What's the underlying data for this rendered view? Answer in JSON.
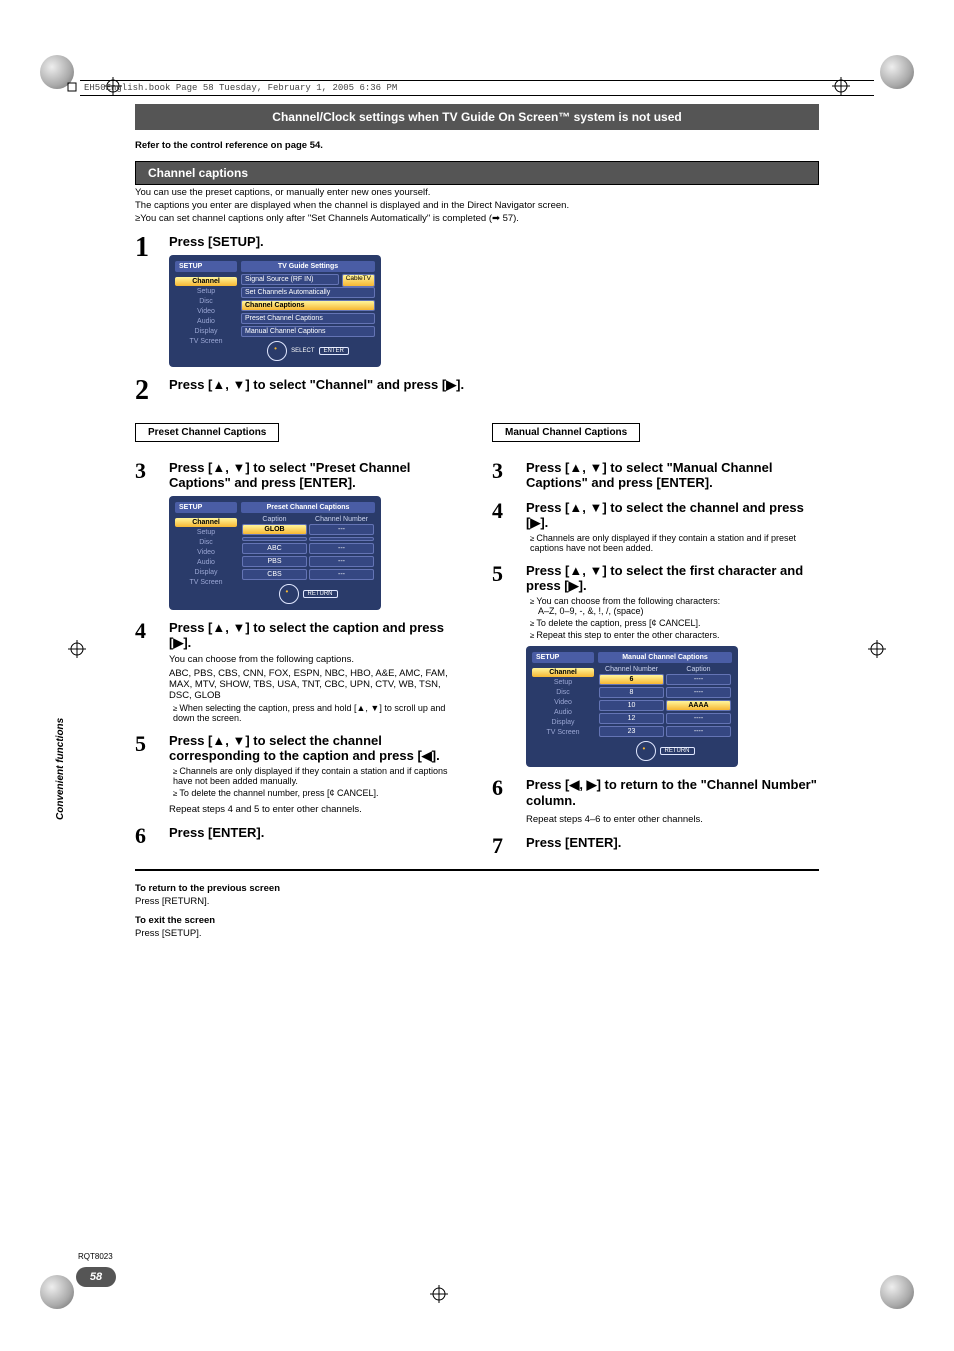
{
  "book_header": "EH50English.book  Page 58  Tuesday, February 1, 2005  6:36 PM",
  "title_bar": "Channel/Clock settings when TV Guide On Screen™ system is not used",
  "ref_line": "Refer to the control reference on page 54.",
  "section_bar": "Channel captions",
  "intro": {
    "p1": "You can use the preset captions, or manually enter new ones yourself.",
    "p2": "The captions you enter are displayed when the channel is displayed and in the Direct Navigator screen.",
    "p3": "You can set channel captions only after \"Set Channels Automatically\" is completed (➡ 57)."
  },
  "step1_title": "Press [SETUP].",
  "step2_title": "Press [▲, ▼] to select \"Channel\" and press [▶].",
  "col_left_label": "Preset Channel Captions",
  "col_right_label": "Manual Channel Captions",
  "left": {
    "s3_title": "Press [▲, ▼] to select \"Preset Channel Captions\" and press [ENTER].",
    "s4_title": "Press [▲, ▼] to select the caption and press [▶].",
    "s4_sub1": "You can choose from the following captions.",
    "s4_sub2": "ABC, PBS, CBS, CNN, FOX, ESPN, NBC, HBO, A&E, AMC, FAM, MAX, MTV, SHOW, TBS, USA, TNT, CBC, UPN, CTV, WB, TSN, DSC, GLOB",
    "s4_b1": "When selecting the caption, press and hold [▲, ▼] to scroll up and down the screen.",
    "s5_title": "Press [▲, ▼] to select the channel corresponding to the caption and press [◀].",
    "s5_b1": "Channels are only displayed if they contain a station and if captions have not been added manually.",
    "s5_b2": "To delete the channel number, press [¢ CANCEL].",
    "s5_sub": "Repeat steps 4 and 5 to enter other channels.",
    "s6_title": "Press [ENTER]."
  },
  "right": {
    "s3_title": "Press [▲, ▼] to select \"Manual Channel Captions\" and press [ENTER].",
    "s4_title": "Press [▲, ▼] to select the channel and press [▶].",
    "s4_b1": "Channels are only displayed if they contain a station and if preset captions have not been added.",
    "s5_title": "Press [▲, ▼] to select the first character and press [▶].",
    "s5_b1": "You can choose from the following characters:",
    "s5_b1b": "A–Z, 0–9, -, &, !, /, (space)",
    "s5_b2": "To delete the caption, press [¢ CANCEL].",
    "s5_b3": "Repeat this step to enter the other characters.",
    "s6_title": "Press [◀, ▶] to return to the \"Channel Number\" column.",
    "s6_sub": "Repeat steps 4–6 to enter other channels.",
    "s7_title": "Press [ENTER]."
  },
  "footer": {
    "r1": "To return to the previous screen",
    "r2": "Press [RETURN].",
    "e1": "To exit the screen",
    "e2": "Press [SETUP]."
  },
  "side_label": "Convenient functions",
  "rqt": "RQT8023",
  "page_num": "58",
  "osd1": {
    "setup": "SETUP",
    "menu": [
      "Channel",
      "Setup",
      "Disc",
      "Video",
      "Audio",
      "Display",
      "TV Screen"
    ],
    "panel_title": "TV Guide Settings",
    "sig_label": "Signal Source (RF IN)",
    "sig_val": "CableTV",
    "items": [
      "Set Channels Automatically",
      "Channel Captions",
      "Preset Channel Captions",
      "Manual Channel Captions"
    ],
    "select": "SELECT",
    "enter": "ENTER"
  },
  "osd2": {
    "setup": "SETUP",
    "menu": [
      "Channel",
      "Setup",
      "Disc",
      "Video",
      "Audio",
      "Display",
      "TV Screen"
    ],
    "panel_title": "Preset Channel Captions",
    "h1": "Caption",
    "h2": "Channel Number",
    "rows": [
      [
        "GLOB",
        "---"
      ],
      [
        "",
        ""
      ],
      [
        "ABC",
        "---"
      ],
      [
        "PBS",
        "---"
      ],
      [
        "CBS",
        "---"
      ]
    ],
    "return": "RETURN"
  },
  "osd3": {
    "setup": "SETUP",
    "menu": [
      "Channel",
      "Setup",
      "Disc",
      "Video",
      "Audio",
      "Display",
      "TV Screen"
    ],
    "panel_title": "Manual Channel Captions",
    "h1": "Channel Number",
    "h2": "Caption",
    "rows": [
      [
        "6",
        "----"
      ],
      [
        "8",
        "----"
      ],
      [
        "10",
        "AAAA"
      ],
      [
        "12",
        "----"
      ],
      [
        "23",
        "----"
      ]
    ],
    "return": "RETURN"
  }
}
